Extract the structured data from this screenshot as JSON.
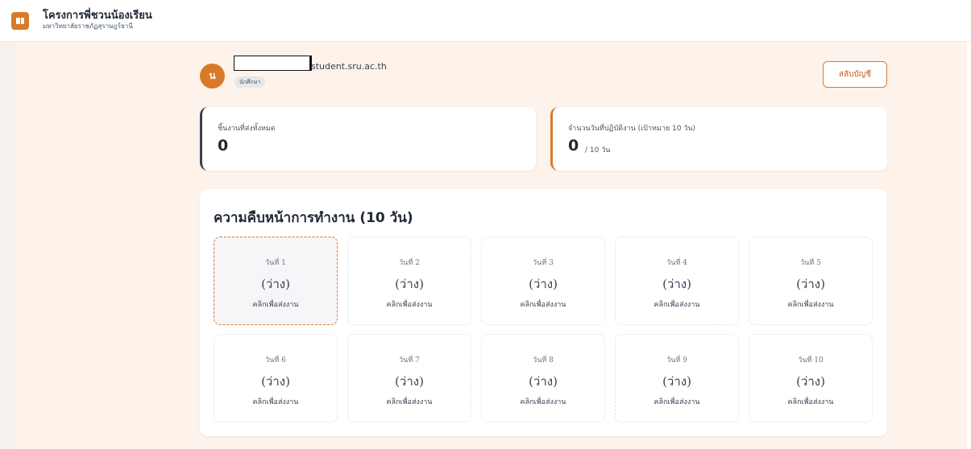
{
  "header": {
    "logo_icon": "book-icon",
    "title": "โครงการพี่ชวนน้องเรียน",
    "subtitle": "มหาวิทยาลัยราชภัฏสุราษฎร์ธานี"
  },
  "profile": {
    "avatar_initial": "น",
    "email_suffix": "student.sru.ac.th",
    "role": "นักศึกษา",
    "switch_account_label": "สลับบัญชี"
  },
  "stats": {
    "total_label": "ชิ้นงานที่ส่งทั้งหมด",
    "total_value": "0",
    "days_label": "จำนวนวันที่ปฏิบัติงาน (เป้าหมาย 10 วัน)",
    "days_value": "0",
    "days_unit": "/ 10 วัน"
  },
  "progress": {
    "title": "ความคืบหน้าการทำงาน (10 วัน)",
    "days": [
      {
        "label": "วันที่ 1",
        "status": "(ว่าง)",
        "action": "คลิกเพื่อส่งงาน"
      },
      {
        "label": "วันที่ 2",
        "status": "(ว่าง)",
        "action": "คลิกเพื่อส่งงาน"
      },
      {
        "label": "วันที่ 3",
        "status": "(ว่าง)",
        "action": "คลิกเพื่อส่งงาน"
      },
      {
        "label": "วันที่ 4",
        "status": "(ว่าง)",
        "action": "คลิกเพื่อส่งงาน"
      },
      {
        "label": "วันที่ 5",
        "status": "(ว่าง)",
        "action": "คลิกเพื่อส่งงาน"
      },
      {
        "label": "วันที่ 6",
        "status": "(ว่าง)",
        "action": "คลิกเพื่อส่งงาน"
      },
      {
        "label": "วันที่ 7",
        "status": "(ว่าง)",
        "action": "คลิกเพื่อส่งงาน"
      },
      {
        "label": "วันที่ 8",
        "status": "(ว่าง)",
        "action": "คลิกเพื่อส่งงาน"
      },
      {
        "label": "วันที่ 9",
        "status": "(ว่าง)",
        "action": "คลิกเพื่อส่งงาน"
      },
      {
        "label": "วันที่ 10",
        "status": "(ว่าง)",
        "action": "คลิกเพื่อส่งงาน"
      }
    ]
  },
  "colors": {
    "accent": "#d97a2b",
    "page_bg": "#fdf3eb",
    "card_bg": "#ffffff"
  }
}
